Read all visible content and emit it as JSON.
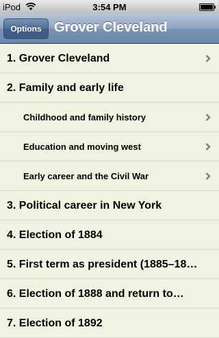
{
  "status_bar": {
    "carrier": "iPod",
    "time": "3:54 PM"
  },
  "nav": {
    "options_label": "Options",
    "title": "Grover Cleveland"
  },
  "items": [
    {
      "label": "1. Grover Cleveland",
      "level": 1,
      "chevron": true
    },
    {
      "label": "2. Family and early life",
      "level": 1,
      "chevron": false
    },
    {
      "label": "Childhood and family history",
      "level": 2,
      "chevron": true
    },
    {
      "label": "Education and moving west",
      "level": 2,
      "chevron": true
    },
    {
      "label": "Early career and the Civil War",
      "level": 2,
      "chevron": true
    },
    {
      "label": "3. Political career in New York",
      "level": 1,
      "chevron": false
    },
    {
      "label": "4. Election of 1884",
      "level": 1,
      "chevron": false
    },
    {
      "label": "5. First term as president (1885–18…",
      "level": 1,
      "chevron": false
    },
    {
      "label": "6. Election of 1888 and return to…",
      "level": 1,
      "chevron": false
    },
    {
      "label": "7. Election of 1892",
      "level": 1,
      "chevron": false
    }
  ]
}
